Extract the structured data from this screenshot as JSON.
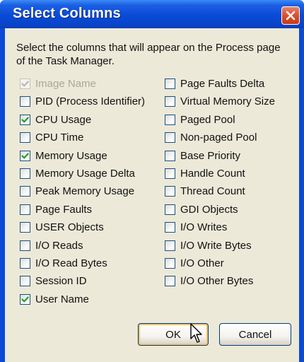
{
  "window": {
    "title": "Select Columns"
  },
  "description": "Select the columns that will appear on the Process page of the Task Manager.",
  "columns_left": [
    {
      "label": "Image Name",
      "checked": true,
      "disabled": true
    },
    {
      "label": "PID (Process Identifier)",
      "checked": false,
      "disabled": false
    },
    {
      "label": "CPU Usage",
      "checked": true,
      "disabled": false
    },
    {
      "label": "CPU Time",
      "checked": false,
      "disabled": false
    },
    {
      "label": "Memory Usage",
      "checked": true,
      "disabled": false
    },
    {
      "label": "Memory Usage Delta",
      "checked": false,
      "disabled": false
    },
    {
      "label": "Peak Memory Usage",
      "checked": false,
      "disabled": false
    },
    {
      "label": "Page Faults",
      "checked": false,
      "disabled": false
    },
    {
      "label": "USER Objects",
      "checked": false,
      "disabled": false
    },
    {
      "label": "I/O Reads",
      "checked": false,
      "disabled": false
    },
    {
      "label": "I/O Read Bytes",
      "checked": false,
      "disabled": false
    },
    {
      "label": "Session ID",
      "checked": false,
      "disabled": false
    },
    {
      "label": "User Name",
      "checked": true,
      "disabled": false
    }
  ],
  "columns_right": [
    {
      "label": "Page Faults Delta",
      "checked": false,
      "disabled": false
    },
    {
      "label": "Virtual Memory Size",
      "checked": false,
      "disabled": false
    },
    {
      "label": "Paged Pool",
      "checked": false,
      "disabled": false
    },
    {
      "label": "Non-paged Pool",
      "checked": false,
      "disabled": false
    },
    {
      "label": "Base Priority",
      "checked": false,
      "disabled": false
    },
    {
      "label": "Handle Count",
      "checked": false,
      "disabled": false
    },
    {
      "label": "Thread Count",
      "checked": false,
      "disabled": false
    },
    {
      "label": "GDI Objects",
      "checked": false,
      "disabled": false
    },
    {
      "label": "I/O Writes",
      "checked": false,
      "disabled": false
    },
    {
      "label": "I/O Write Bytes",
      "checked": false,
      "disabled": false
    },
    {
      "label": "I/O Other",
      "checked": false,
      "disabled": false
    },
    {
      "label": "I/O Other Bytes",
      "checked": false,
      "disabled": false
    }
  ],
  "buttons": {
    "ok": "OK",
    "cancel": "Cancel"
  },
  "icons": {
    "close": "close-icon",
    "check": "checkmark-icon",
    "cursor": "mouse-pointer-icon"
  },
  "colors": {
    "title_bar": "#0a4ad6",
    "close_button": "#d9502c",
    "dialog_face": "#ece9d8",
    "checkmark": "#21a121",
    "disabled_text": "#a9a89b",
    "default_button_ring": "#f6c46a"
  }
}
